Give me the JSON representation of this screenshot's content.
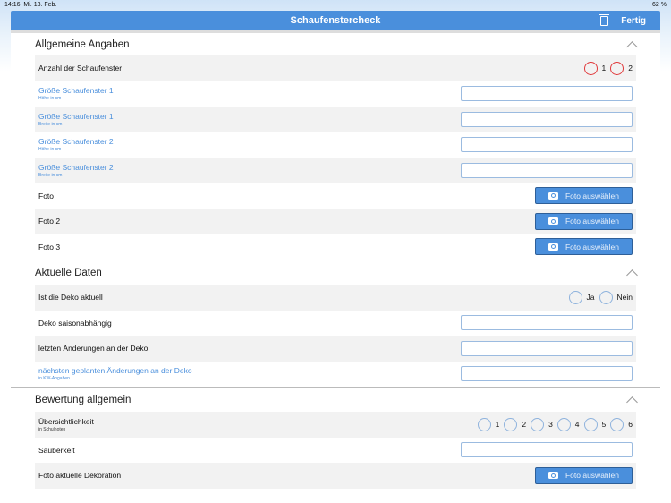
{
  "status": {
    "time": "14:16",
    "date": "Mi. 13. Feb.",
    "battery": "62 %"
  },
  "header": {
    "title": "Schaufenstercheck",
    "done": "Fertig"
  },
  "sections": [
    {
      "title": "Allgemeine Angaben",
      "rows": [
        {
          "label": "Anzahl der Schaufenster",
          "type": "radio",
          "options": [
            "1",
            "2"
          ],
          "red": true
        },
        {
          "label": "Größe Schaufenster 1",
          "sub": "Höhe in cm",
          "type": "input",
          "blue": true
        },
        {
          "label": "Größe Schaufenster 1",
          "sub": "Breite in cm",
          "type": "input",
          "blue": true
        },
        {
          "label": "Größe Schaufenster 2",
          "sub": "Höhe in cm",
          "type": "input",
          "blue": true
        },
        {
          "label": "Größe Schaufenster 2",
          "sub": "Breite in cm",
          "type": "input",
          "blue": true
        },
        {
          "label": "Foto",
          "type": "button",
          "button": "Foto auswählen"
        },
        {
          "label": "Foto 2",
          "type": "button",
          "button": "Foto auswählen"
        },
        {
          "label": "Foto 3",
          "type": "button",
          "button": "Foto auswählen"
        }
      ]
    },
    {
      "title": "Aktuelle Daten",
      "rows": [
        {
          "label": "Ist die Deko aktuell",
          "type": "radio",
          "options": [
            "Ja",
            "Nein"
          ]
        },
        {
          "label": "Deko saisonabhängig",
          "type": "input"
        },
        {
          "label": "letzten Änderungen an der Deko",
          "type": "input"
        },
        {
          "label": "nächsten geplanten Änderungen an der Deko",
          "sub": "in KW-Angaben",
          "type": "input",
          "blue": true
        }
      ]
    },
    {
      "title": "Bewertung allgemein",
      "rows": [
        {
          "label": "Übersichtlichkeit",
          "sub": "in Schulnoten",
          "type": "radio",
          "options": [
            "1",
            "2",
            "3",
            "4",
            "5",
            "6"
          ],
          "darksub": true
        },
        {
          "label": "Sauberkeit",
          "type": "input"
        },
        {
          "label": "Foto aktuelle Dekoration",
          "type": "button",
          "button": "Foto auswählen"
        }
      ]
    }
  ]
}
